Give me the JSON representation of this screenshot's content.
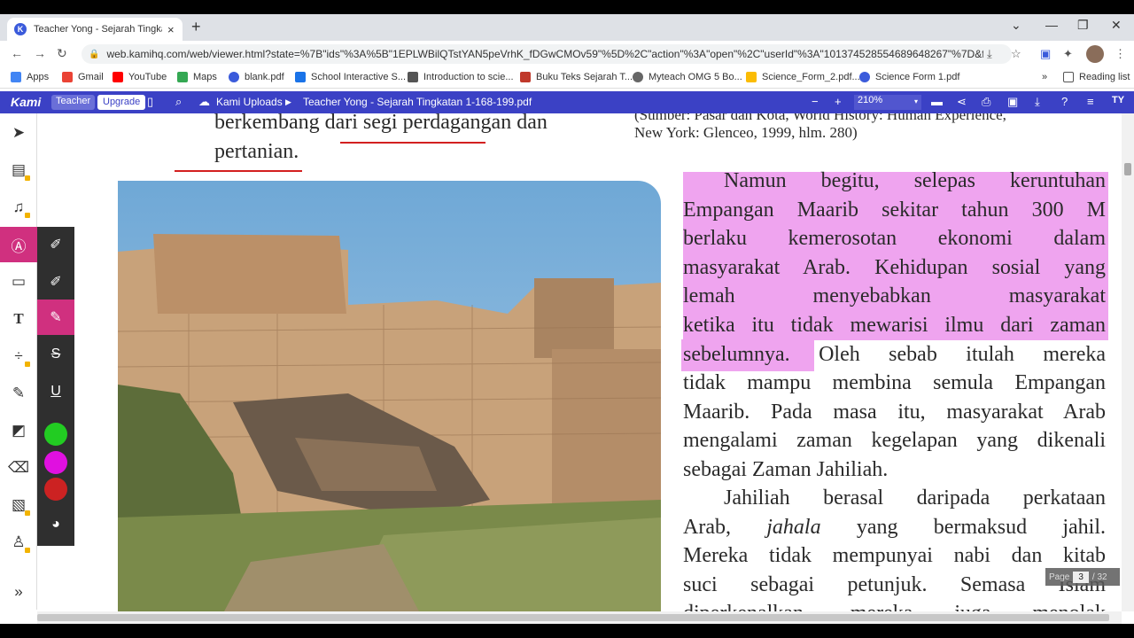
{
  "browser": {
    "tab_title": "Teacher Yong - Sejarah Tingkatan 1-168-199.pdf",
    "url": "web.kamihq.com/web/viewer.html?state=%7B\"ids\"%3A%5B\"1EPLWBilQTstYAN5peVrhK_fDGwCMOv59\"%5D%2C\"action\"%3A\"open\"%2C\"userId\"%3A\"101374528554689648267\"%7D&filenam...",
    "bookmarks": [
      "Apps",
      "Gmail",
      "YouTube",
      "Maps",
      "blank.pdf",
      "School Interactive S...",
      "Introduction to scie...",
      "Buku Teks Sejarah T...",
      "Myteach OMG 5 Bo...",
      "Science_Form_2.pdf...",
      "Science Form 1.pdf"
    ],
    "reading_list": "Reading list",
    "bookmark_colors": [
      "#4285f4",
      "#ea4335",
      "#ff0000",
      "#34a853",
      "#3b5bdb",
      "#1a73e8",
      "#555555",
      "#c0392b",
      "#666666",
      "#fbbc04",
      "#3b5bdb"
    ]
  },
  "kami": {
    "logo": "Kami",
    "role": "Teacher",
    "upgrade": "Upgrade",
    "breadcrumb_folder": "Kami Uploads",
    "file_title": "Teacher Yong - Sejarah Tingkatan 1-168-199.pdf",
    "zoom": "210%",
    "user_initials": "TY"
  },
  "colors": {
    "kami_bar": "#3b41c5",
    "active_tool": "#d0307f",
    "highlight": "#efa4ef",
    "swatch_green": "#22cc22",
    "swatch_magenta": "#e010e0",
    "swatch_red": "#cc2222"
  },
  "document": {
    "top_left_lines": [
      "berkembang dari segi perdagangan dan",
      "pertanian."
    ],
    "citation_lines": [
      "(Sumber: Pasar dan Kota, World History: Human Experience,",
      "New York: Glenceo, 1999, hlm. 280)"
    ],
    "para1_lines": [
      "Namun begitu, selepas keruntuhan",
      "Empangan Maarib sekitar tahun 300 M",
      "berlaku kemerosotan ekonomi dalam",
      "masyarakat Arab. Kehidupan sosial yang",
      "lemah menyebabkan masyarakat",
      "ketika itu tidak mewarisi ilmu dari zaman",
      "sebelumnya. Oleh sebab itulah mereka",
      "tidak mampu membina semula Empangan",
      "Maarib. Pada masa itu, masyarakat Arab",
      "mengalami zaman kegelapan yang dikenali",
      "sebagai Zaman Jahiliah."
    ],
    "para2_lines": [
      "Jahiliah berasal daripada perkataan",
      "Arab, jahala yang bermaksud jahil.",
      "Mereka tidak mempunyai nabi dan kitab",
      "suci sebagai petunjuk. Semasa Islam",
      "diperkenalkan, mereka juga menolak"
    ],
    "page_label": "Page",
    "page_current": "3",
    "page_total": "/ 32"
  }
}
